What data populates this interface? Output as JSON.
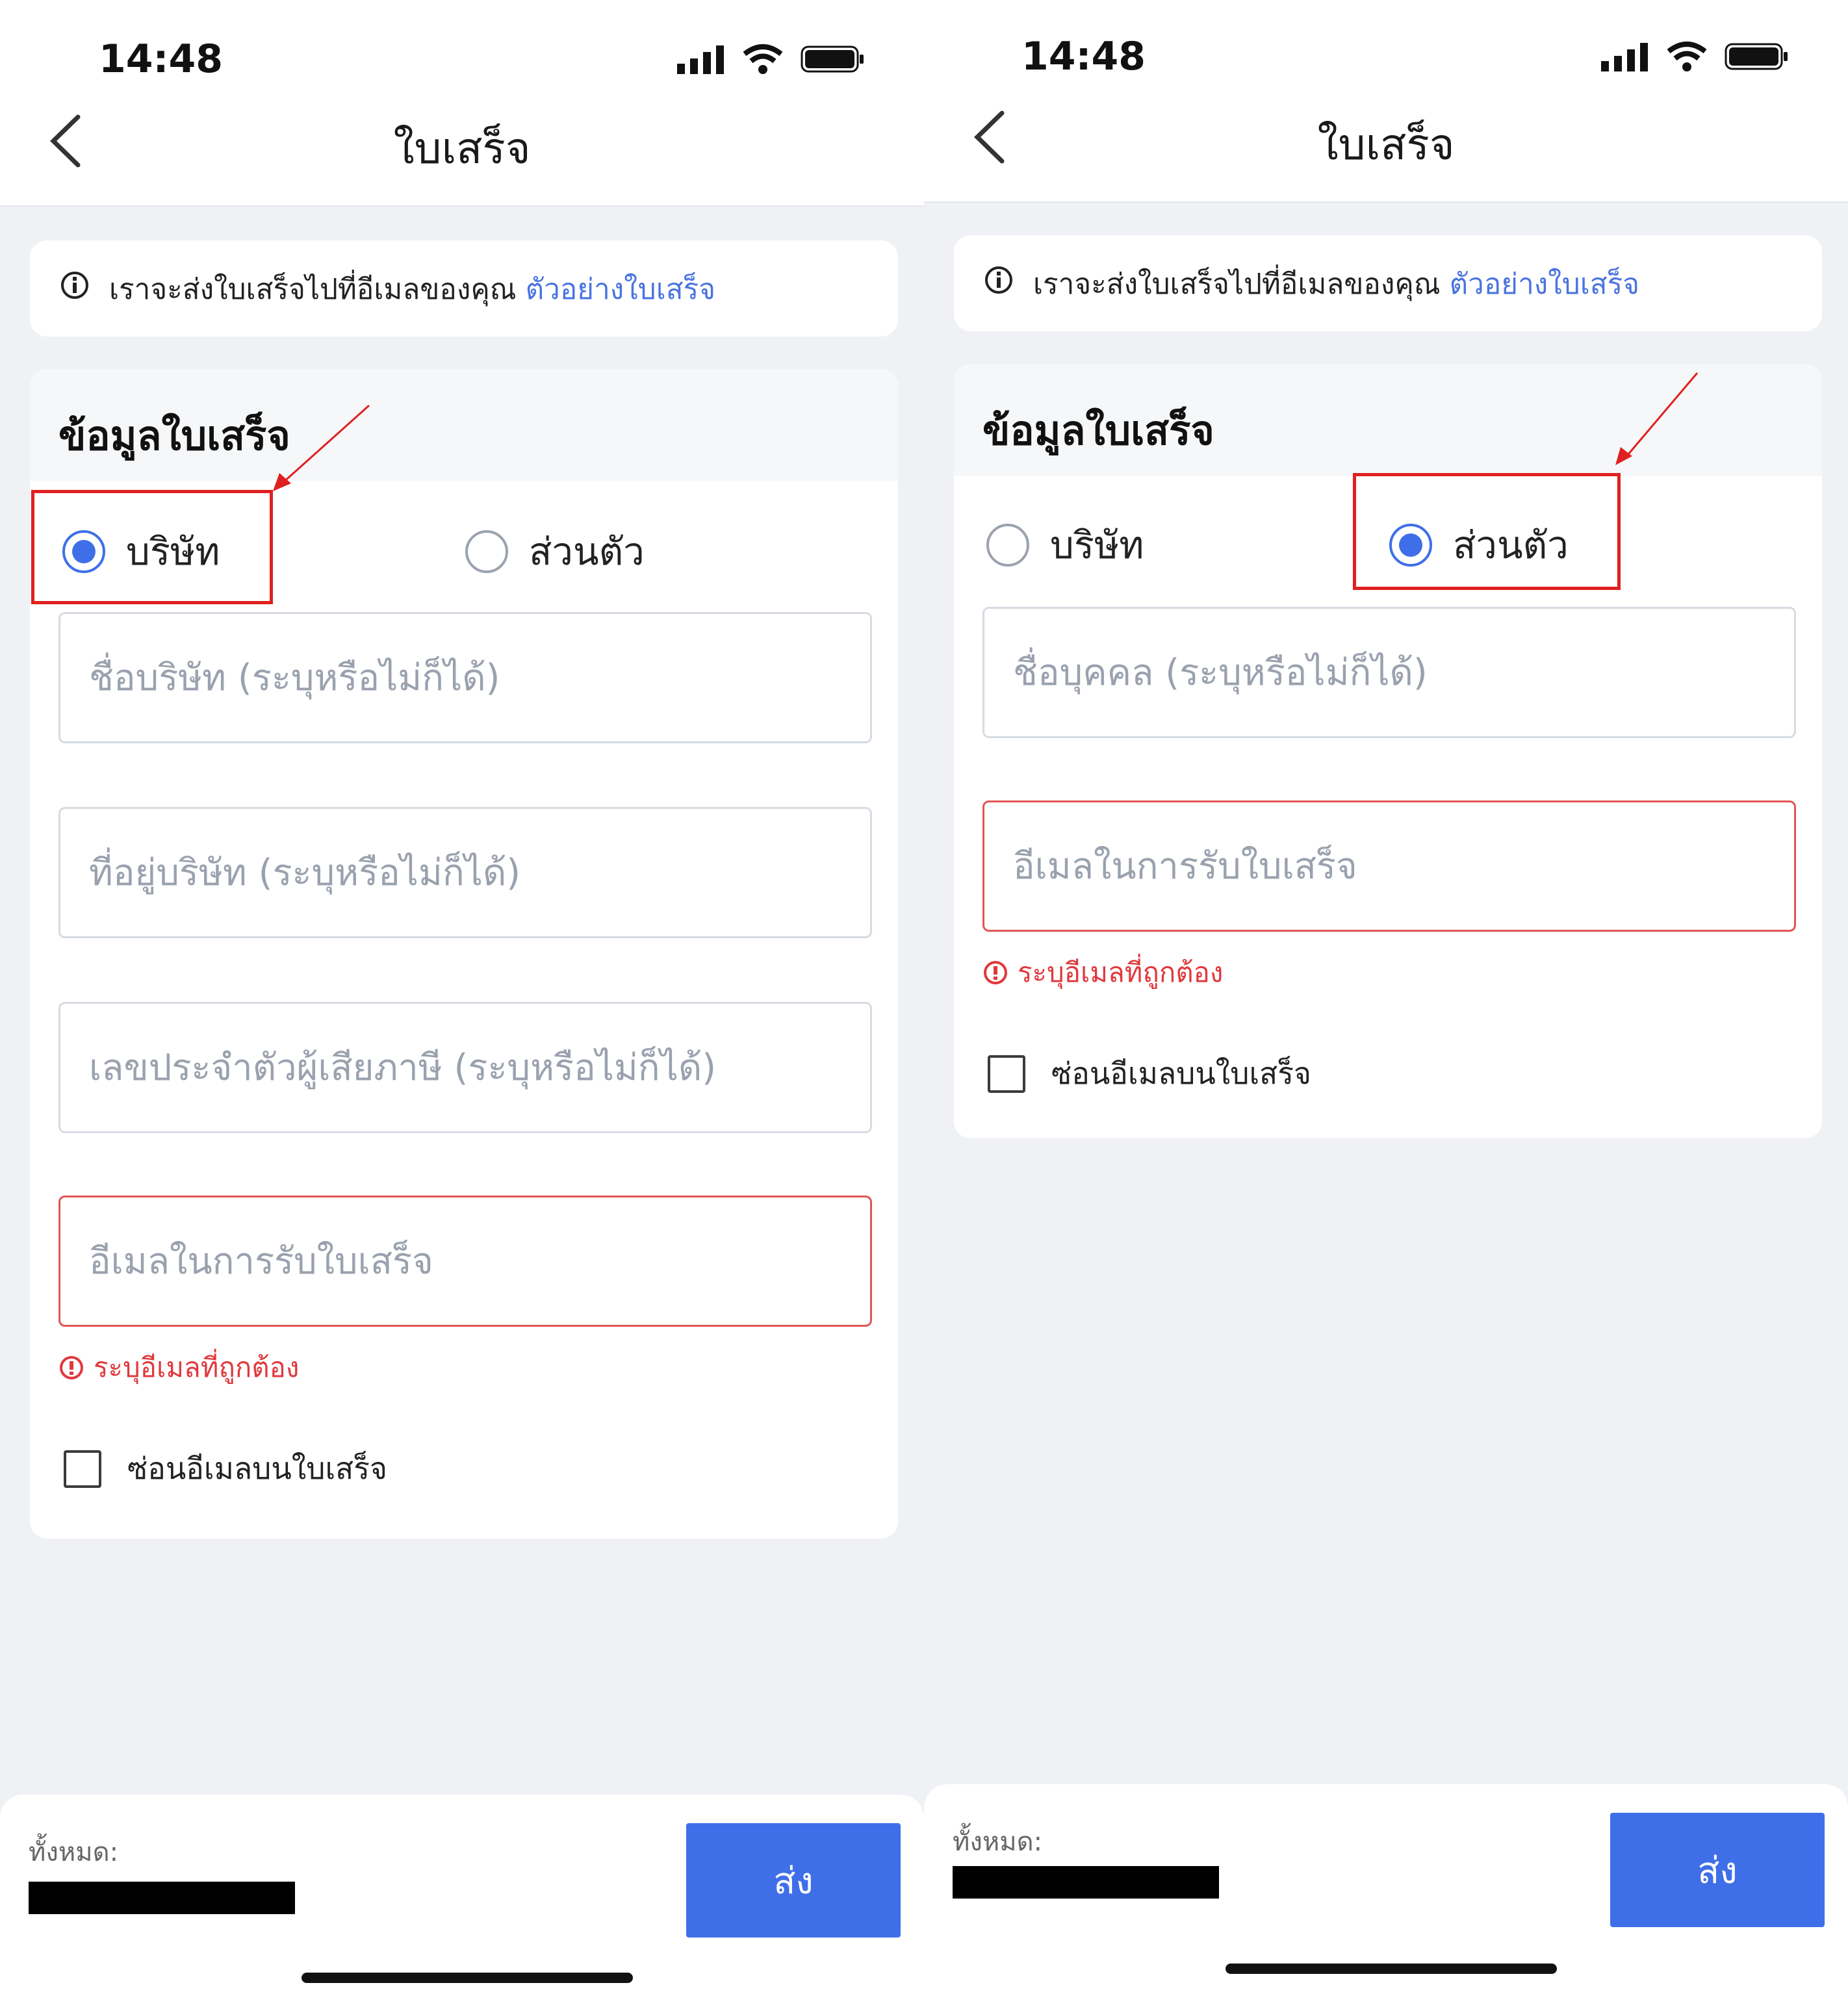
{
  "left": {
    "status": {
      "time": "14:48"
    },
    "title": "ใบเสร็จ",
    "info": {
      "text": "เราจะส่งใบเสร็จไปที่อีเมลของคุณ",
      "link": "ตัวอย่างใบเสร็จ"
    },
    "form_title": "ข้อมูลใบเสร็จ",
    "radio_company": "บริษัท",
    "radio_personal": "ส่วนตัว",
    "selected": "บริษัท",
    "fields": {
      "company_name": "ชื่อบริษัท (ระบุหรือไม่ก็ได้)",
      "company_address": "ที่อยู่บริษัท (ระบุหรือไม่ก็ได้)",
      "tax_id": "เลขประจำตัวผู้เสียภาษี (ระบุหรือไม่ก็ได้)",
      "email": "อีเมลในการรับใบเสร็จ"
    },
    "error": "ระบุอีเมลที่ถูกต้อง",
    "hide_email": "ซ่อนอีเมลบนใบเสร็จ",
    "total_label": "ทั้งหมด:",
    "send": "ส่ง"
  },
  "right": {
    "status": {
      "time": "14:48"
    },
    "title": "ใบเสร็จ",
    "info": {
      "text": "เราจะส่งใบเสร็จไปที่อีเมลของคุณ",
      "link": "ตัวอย่างใบเสร็จ"
    },
    "form_title": "ข้อมูลใบเสร็จ",
    "radio_company": "บริษัท",
    "radio_personal": "ส่วนตัว",
    "selected": "ส่วนตัว",
    "fields": {
      "person_name": "ชื่อบุคคล (ระบุหรือไม่ก็ได้)",
      "email": "อีเมลในการรับใบเสร็จ"
    },
    "error": "ระบุอีเมลที่ถูกต้อง",
    "hide_email": "ซ่อนอีเมลบนใบเสร็จ",
    "total_label": "ทั้งหมด:",
    "send": "ส่ง"
  },
  "colors": {
    "accent": "#3f6fe8",
    "error": "#e0393d",
    "highlight": "#e02020",
    "link": "#4a74e0"
  }
}
